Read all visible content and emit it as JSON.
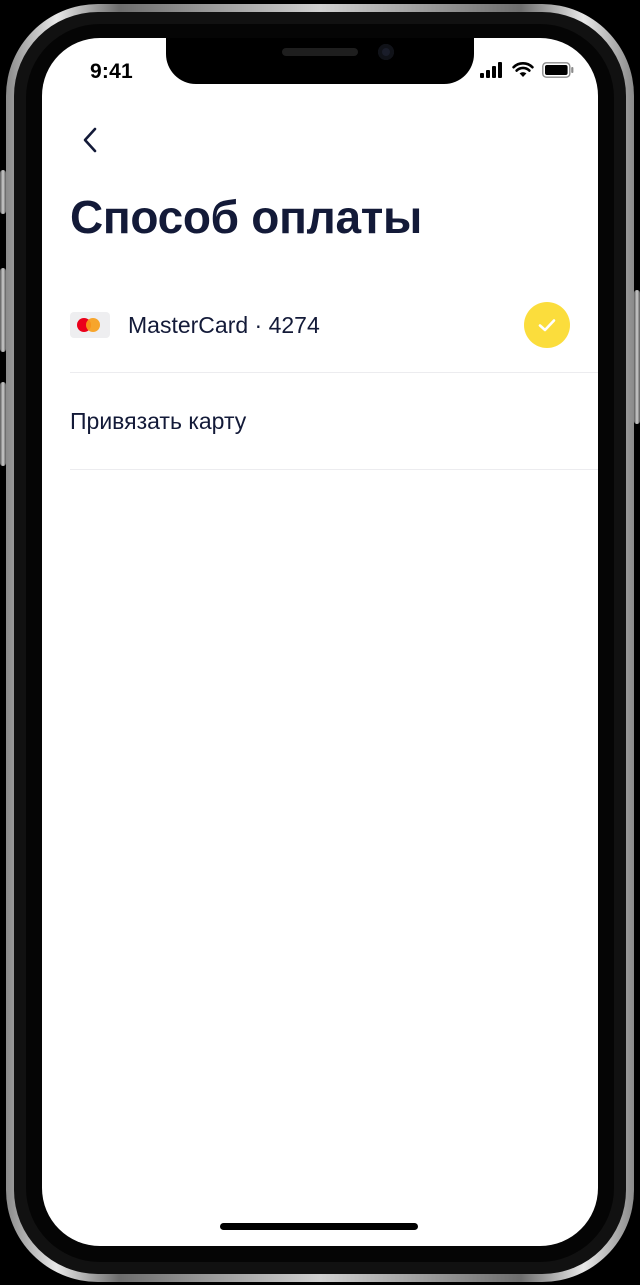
{
  "status_bar": {
    "time": "9:41",
    "icons": [
      "signal-icon",
      "wifi-icon",
      "battery-icon"
    ]
  },
  "header": {
    "back_icon": "chevron-left-icon",
    "title": "Способ оплаты"
  },
  "payment_methods": [
    {
      "label": "MasterCard · 4274",
      "icon": "mastercard-icon",
      "selected": true,
      "selected_icon": "checkmark-icon"
    }
  ],
  "actions": {
    "link_card_label": "Привязать карту"
  },
  "colors": {
    "title": "#131a38",
    "accent": "#fbdd3c",
    "divider": "#ececef",
    "mastercard_red": "#eb001b",
    "mastercard_orange": "#f79e1b"
  }
}
